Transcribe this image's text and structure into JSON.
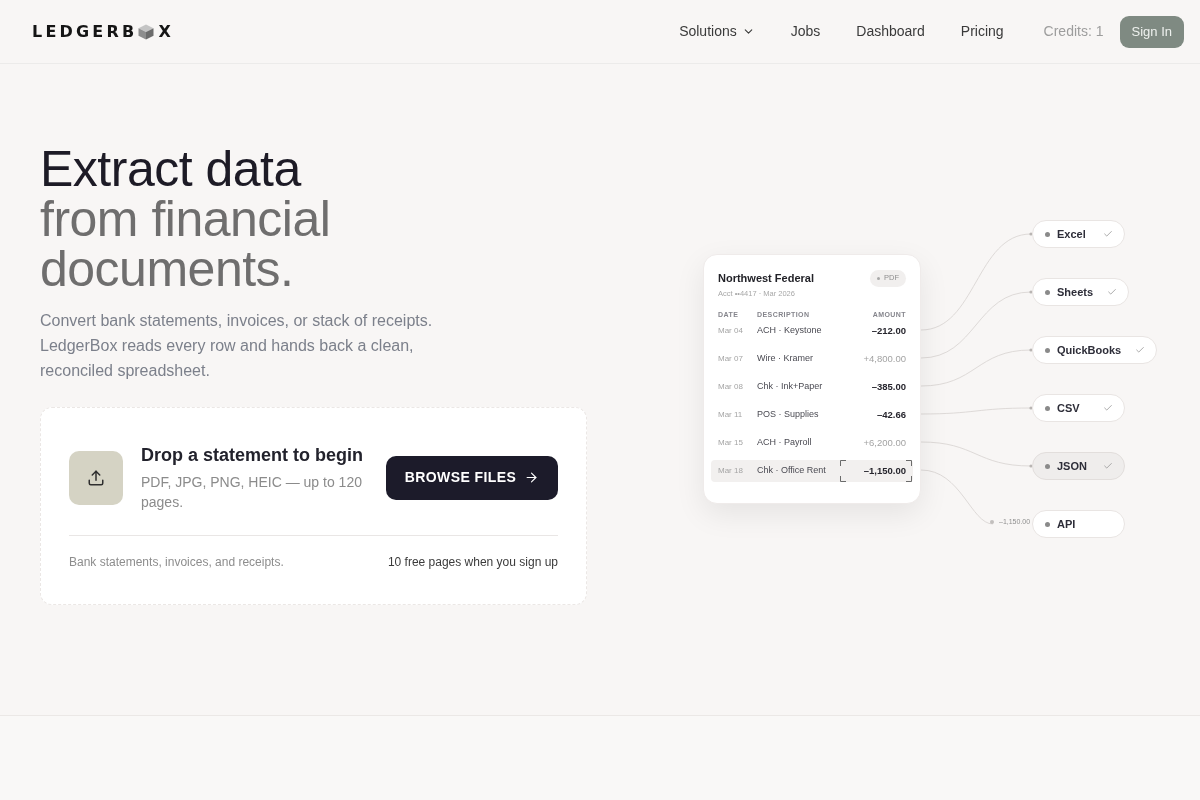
{
  "header": {
    "logo": {
      "text_before_icon": "LEDGERB",
      "text_after_icon": "X"
    },
    "nav": [
      {
        "label": "Solutions",
        "kind": "dropdown"
      },
      {
        "label": "Jobs",
        "kind": "link"
      },
      {
        "label": "Dashboard",
        "kind": "link"
      },
      {
        "label": "Pricing",
        "kind": "link"
      }
    ],
    "credits": "Credits: 1",
    "sign_in": "Sign In"
  },
  "hero": {
    "title": "Extract data",
    "title_muted": "from financial documents.",
    "description": "Convert bank statements, invoices, or stack of receipts. LedgerBox reads every row and hands back a clean, reconciled spreadsheet."
  },
  "upload": {
    "title": "Drop a statement to begin",
    "formats": "PDF, JPG, PNG, HEIC — up to 120 pages.",
    "button": "BROWSE FILES",
    "note": "Bank statements, invoices, and receipts.",
    "offer": "10 free pages when you sign up"
  },
  "statement": {
    "bank": "Northwest Federal",
    "badge": "PDF",
    "account": "Acct ••4417 · Mar 2026",
    "columns": [
      "DATE",
      "DESCRIPTION",
      "AMOUNT"
    ],
    "rows": [
      {
        "date": "Mar 04",
        "description": "ACH · Keystone",
        "amount": "–212.00",
        "kind": "debit",
        "selected": false
      },
      {
        "date": "Mar 07",
        "description": "Wire · Kramer",
        "amount": "+4,800.00",
        "kind": "credit",
        "selected": false
      },
      {
        "date": "Mar 08",
        "description": "Chk · Ink+Paper",
        "amount": "–385.00",
        "kind": "debit",
        "selected": false
      },
      {
        "date": "Mar 11",
        "description": "POS · Supplies",
        "amount": "–42.66",
        "kind": "debit",
        "selected": false
      },
      {
        "date": "Mar 15",
        "description": "ACH · Payroll",
        "amount": "+6,200.00",
        "kind": "credit",
        "selected": false
      },
      {
        "date": "Mar 18",
        "description": "Chk · Office Rent",
        "amount": "–1,150.00",
        "kind": "debit",
        "selected": true
      }
    ]
  },
  "outputs": [
    {
      "label": "Excel",
      "checked": true,
      "selected": false
    },
    {
      "label": "Sheets",
      "checked": true,
      "selected": false
    },
    {
      "label": "QuickBooks",
      "checked": true,
      "selected": false
    },
    {
      "label": "CSV",
      "checked": true,
      "selected": false
    },
    {
      "label": "JSON",
      "checked": true,
      "selected": true
    },
    {
      "label": "API",
      "checked": false,
      "selected": false
    }
  ],
  "transfer": {
    "amount": "–1,150.00"
  }
}
